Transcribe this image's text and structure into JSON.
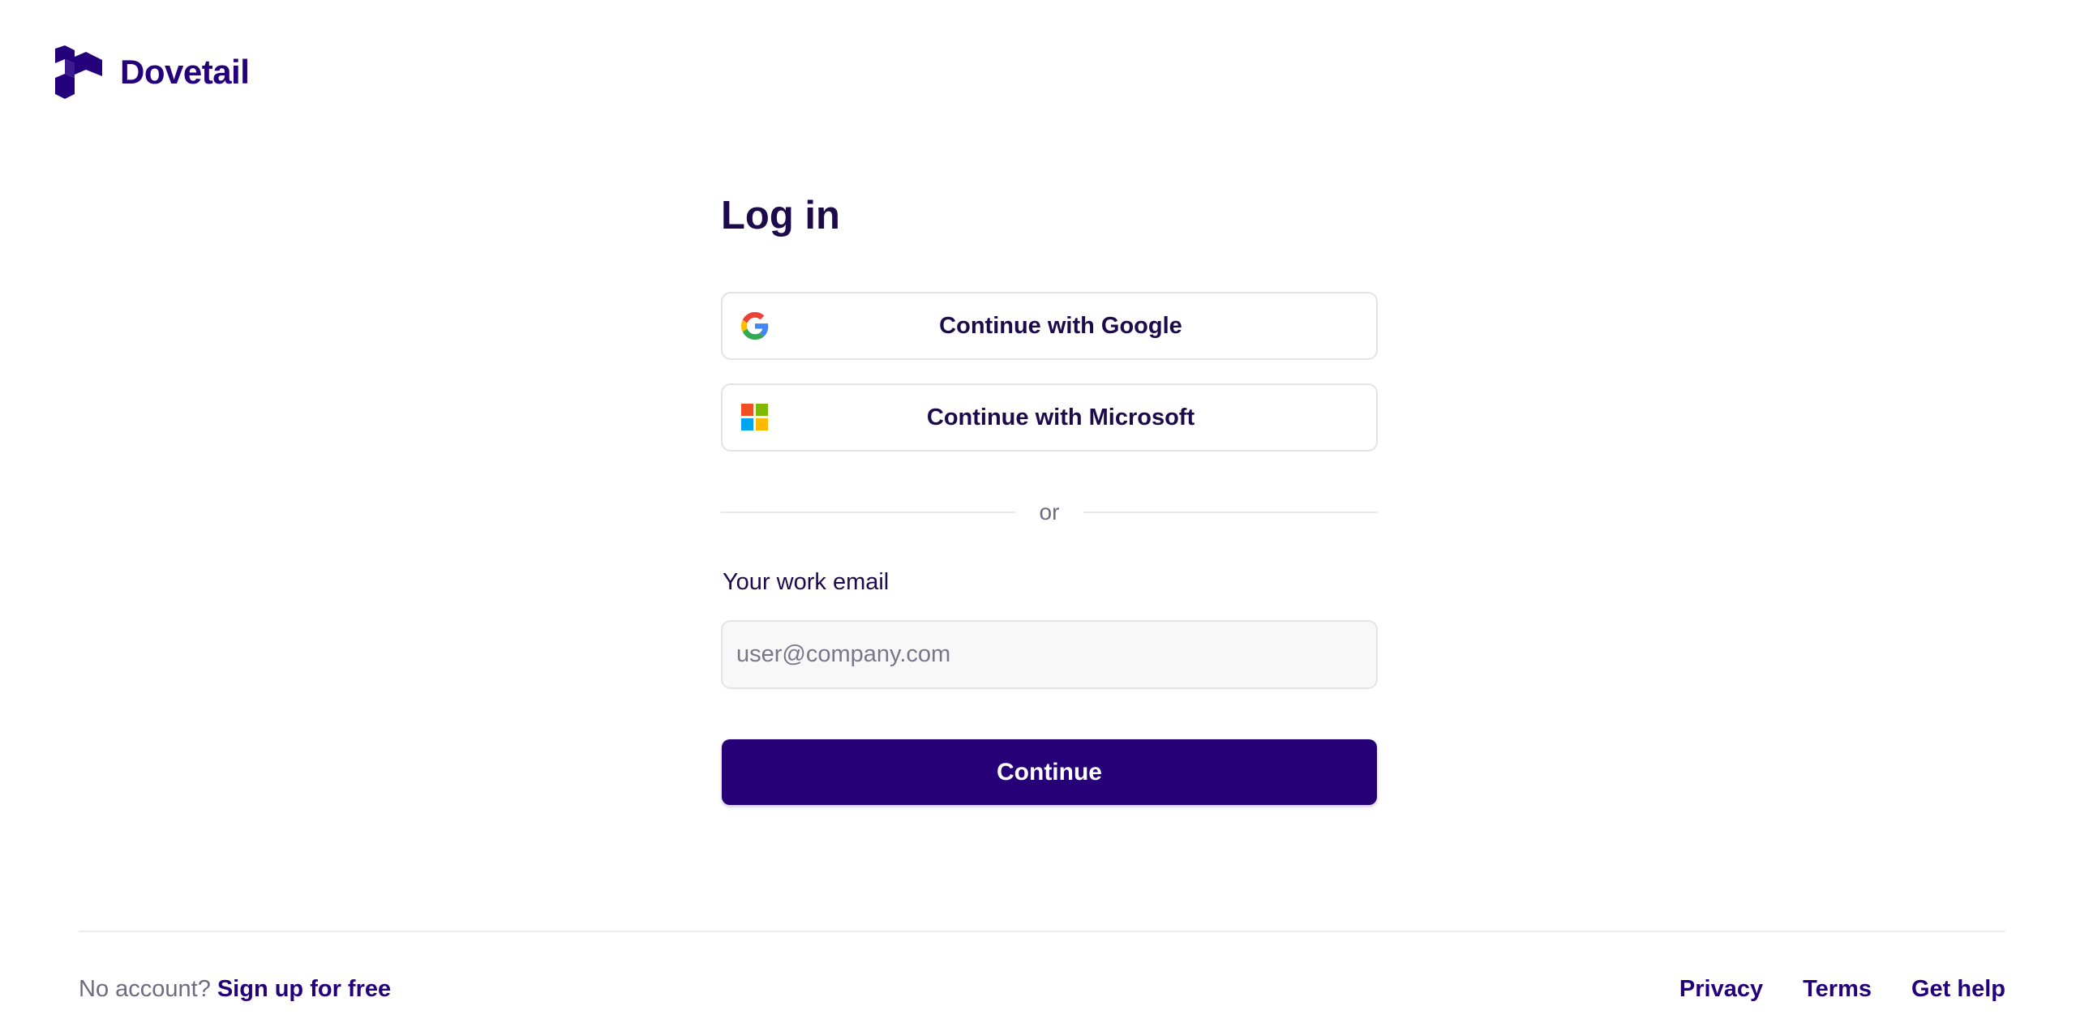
{
  "brand": {
    "name": "Dovetail",
    "color": "#24007a"
  },
  "login": {
    "title": "Log in",
    "google_label": "Continue with Google",
    "microsoft_label": "Continue with Microsoft",
    "divider_text": "or",
    "email_label": "Your work email",
    "email_placeholder": "user@company.com",
    "email_value": "",
    "continue_label": "Continue"
  },
  "icons": {
    "logo": "dovetail-logo-icon",
    "google": "google-icon",
    "microsoft": "microsoft-icon"
  },
  "footer": {
    "no_account_text": "No account?",
    "signup_link": "Sign up for free",
    "links": [
      "Privacy",
      "Terms",
      "Get help"
    ]
  },
  "colors": {
    "primary": "#260076",
    "text": "#1c0a4a",
    "muted": "#6e6a80",
    "border": "#e4e4e8"
  }
}
